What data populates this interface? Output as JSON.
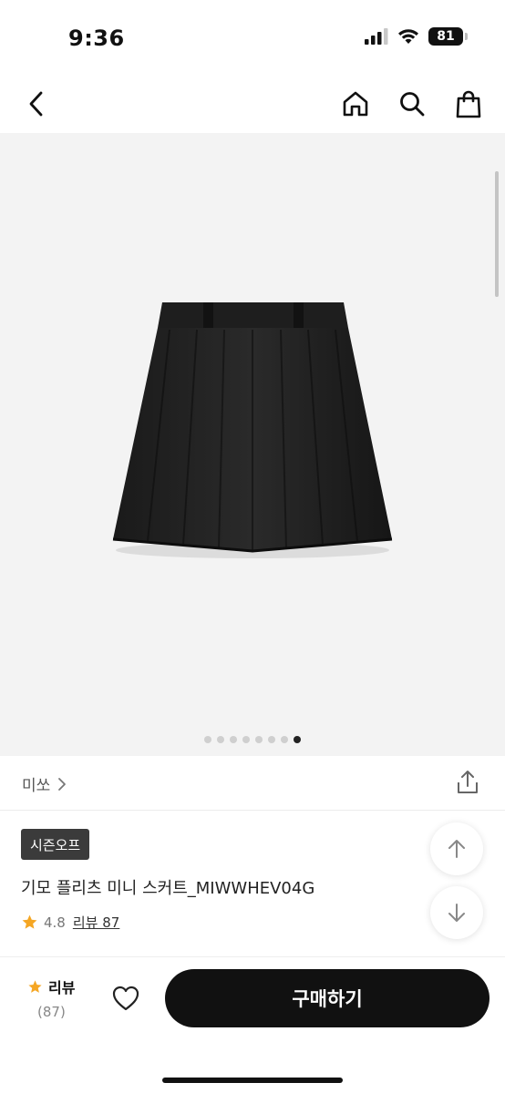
{
  "status": {
    "time": "9:36",
    "battery": "81"
  },
  "nav": {
    "icons": [
      "chevron-left-icon",
      "home-icon",
      "search-icon",
      "shopping-bag-icon"
    ]
  },
  "gallery": {
    "image_count": 8,
    "active_index": 7
  },
  "brand": {
    "name": "미쏘"
  },
  "product": {
    "tag": "시즌오프",
    "title": "기모 플리츠 미니 스커트_MIWWHEV04G",
    "rating": "4.8",
    "review_label": "리뷰 87"
  },
  "bottom": {
    "review_label": "리뷰",
    "review_count": "(87)",
    "buy_label": "구매하기"
  },
  "colors": {
    "accent": "#111111",
    "star": "#f5a623",
    "tag_bg": "#3b3b3b"
  }
}
